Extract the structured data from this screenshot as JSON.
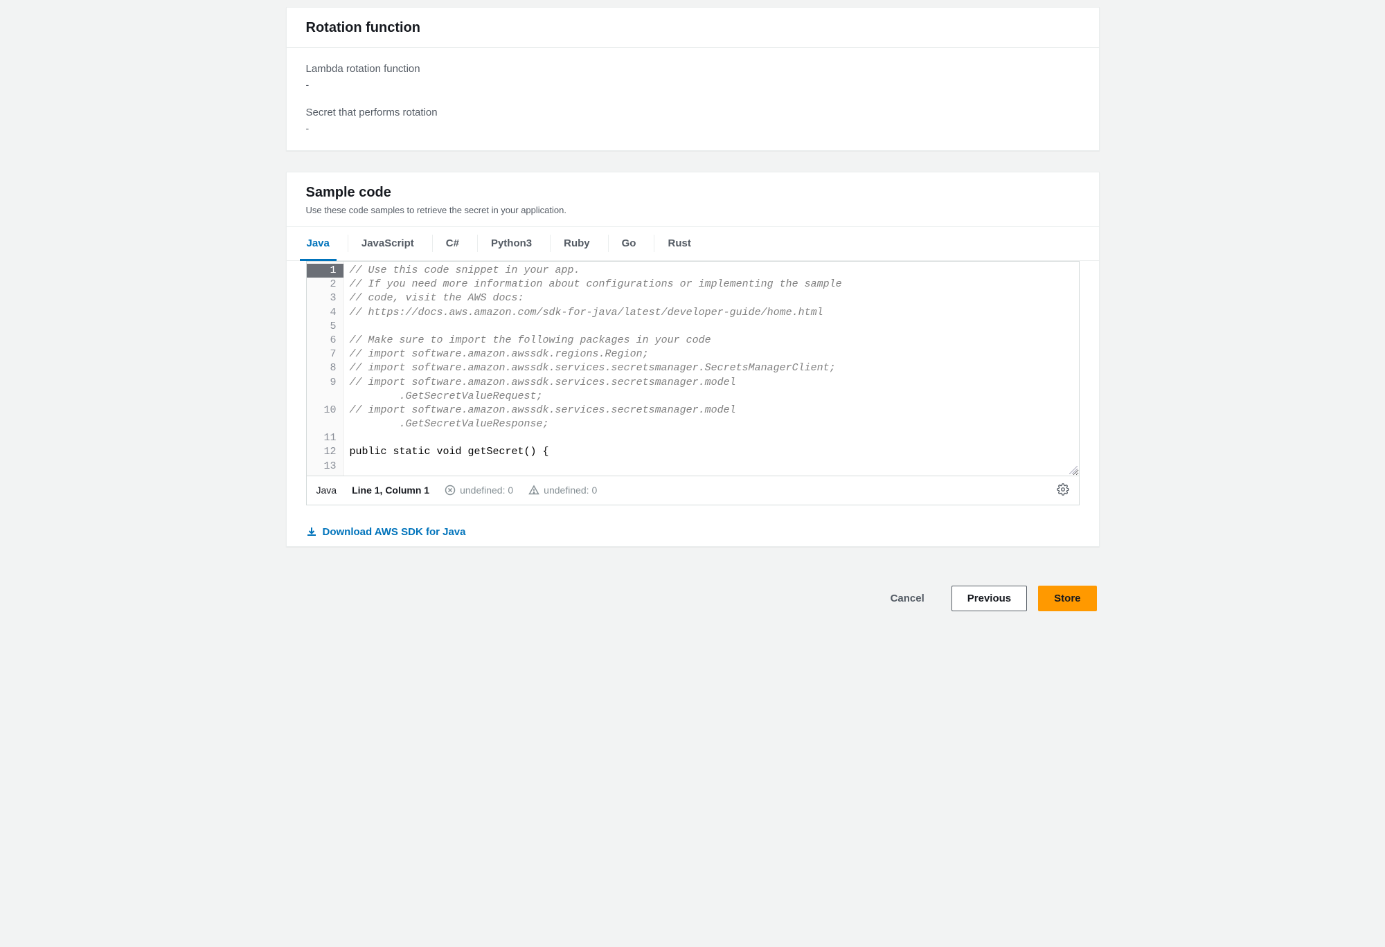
{
  "rotation_panel": {
    "title": "Rotation function",
    "lambda_label": "Lambda rotation function",
    "lambda_value": "-",
    "secret_label": "Secret that performs rotation",
    "secret_value": "-"
  },
  "sample_panel": {
    "title": "Sample code",
    "subtitle": "Use these code samples to retrieve the secret in your application.",
    "tabs": [
      {
        "label": "Java",
        "active": true
      },
      {
        "label": "JavaScript",
        "active": false
      },
      {
        "label": "C#",
        "active": false
      },
      {
        "label": "Python3",
        "active": false
      },
      {
        "label": "Ruby",
        "active": false
      },
      {
        "label": "Go",
        "active": false
      },
      {
        "label": "Rust",
        "active": false
      }
    ],
    "code": {
      "lines": [
        {
          "n": 1,
          "text": "// Use this code snippet in your app.",
          "cls": "comment",
          "hl": true
        },
        {
          "n": 2,
          "text": "// If you need more information about configurations or implementing the sample",
          "cls": "comment"
        },
        {
          "n": 3,
          "text": "// code, visit the AWS docs:",
          "cls": "comment"
        },
        {
          "n": 4,
          "text": "// https://docs.aws.amazon.com/sdk-for-java/latest/developer-guide/home.html",
          "cls": "comment"
        },
        {
          "n": 5,
          "text": "",
          "cls": ""
        },
        {
          "n": 6,
          "text": "// Make sure to import the following packages in your code",
          "cls": "comment"
        },
        {
          "n": 7,
          "text": "// import software.amazon.awssdk.regions.Region;",
          "cls": "comment"
        },
        {
          "n": 8,
          "text": "// import software.amazon.awssdk.services.secretsmanager.SecretsManagerClient;",
          "cls": "comment"
        },
        {
          "n": 9,
          "text": "// import software.amazon.awssdk.services.secretsmanager.model\n        .GetSecretValueRequest;",
          "cls": "comment",
          "wrap": true
        },
        {
          "n": 10,
          "text": "// import software.amazon.awssdk.services.secretsmanager.model\n        .GetSecretValueResponse;",
          "cls": "comment",
          "wrap": true
        },
        {
          "n": 11,
          "text": "",
          "cls": ""
        },
        {
          "n": 12,
          "text": "public static void getSecret() {",
          "cls": "kw"
        },
        {
          "n": 13,
          "text": "",
          "cls": ""
        }
      ]
    },
    "status": {
      "language": "Java",
      "position": "Line 1, Column 1",
      "errors_label": "undefined: 0",
      "warnings_label": "undefined: 0"
    },
    "download_label": "Download AWS SDK for Java"
  },
  "actions": {
    "cancel": "Cancel",
    "previous": "Previous",
    "store": "Store"
  }
}
